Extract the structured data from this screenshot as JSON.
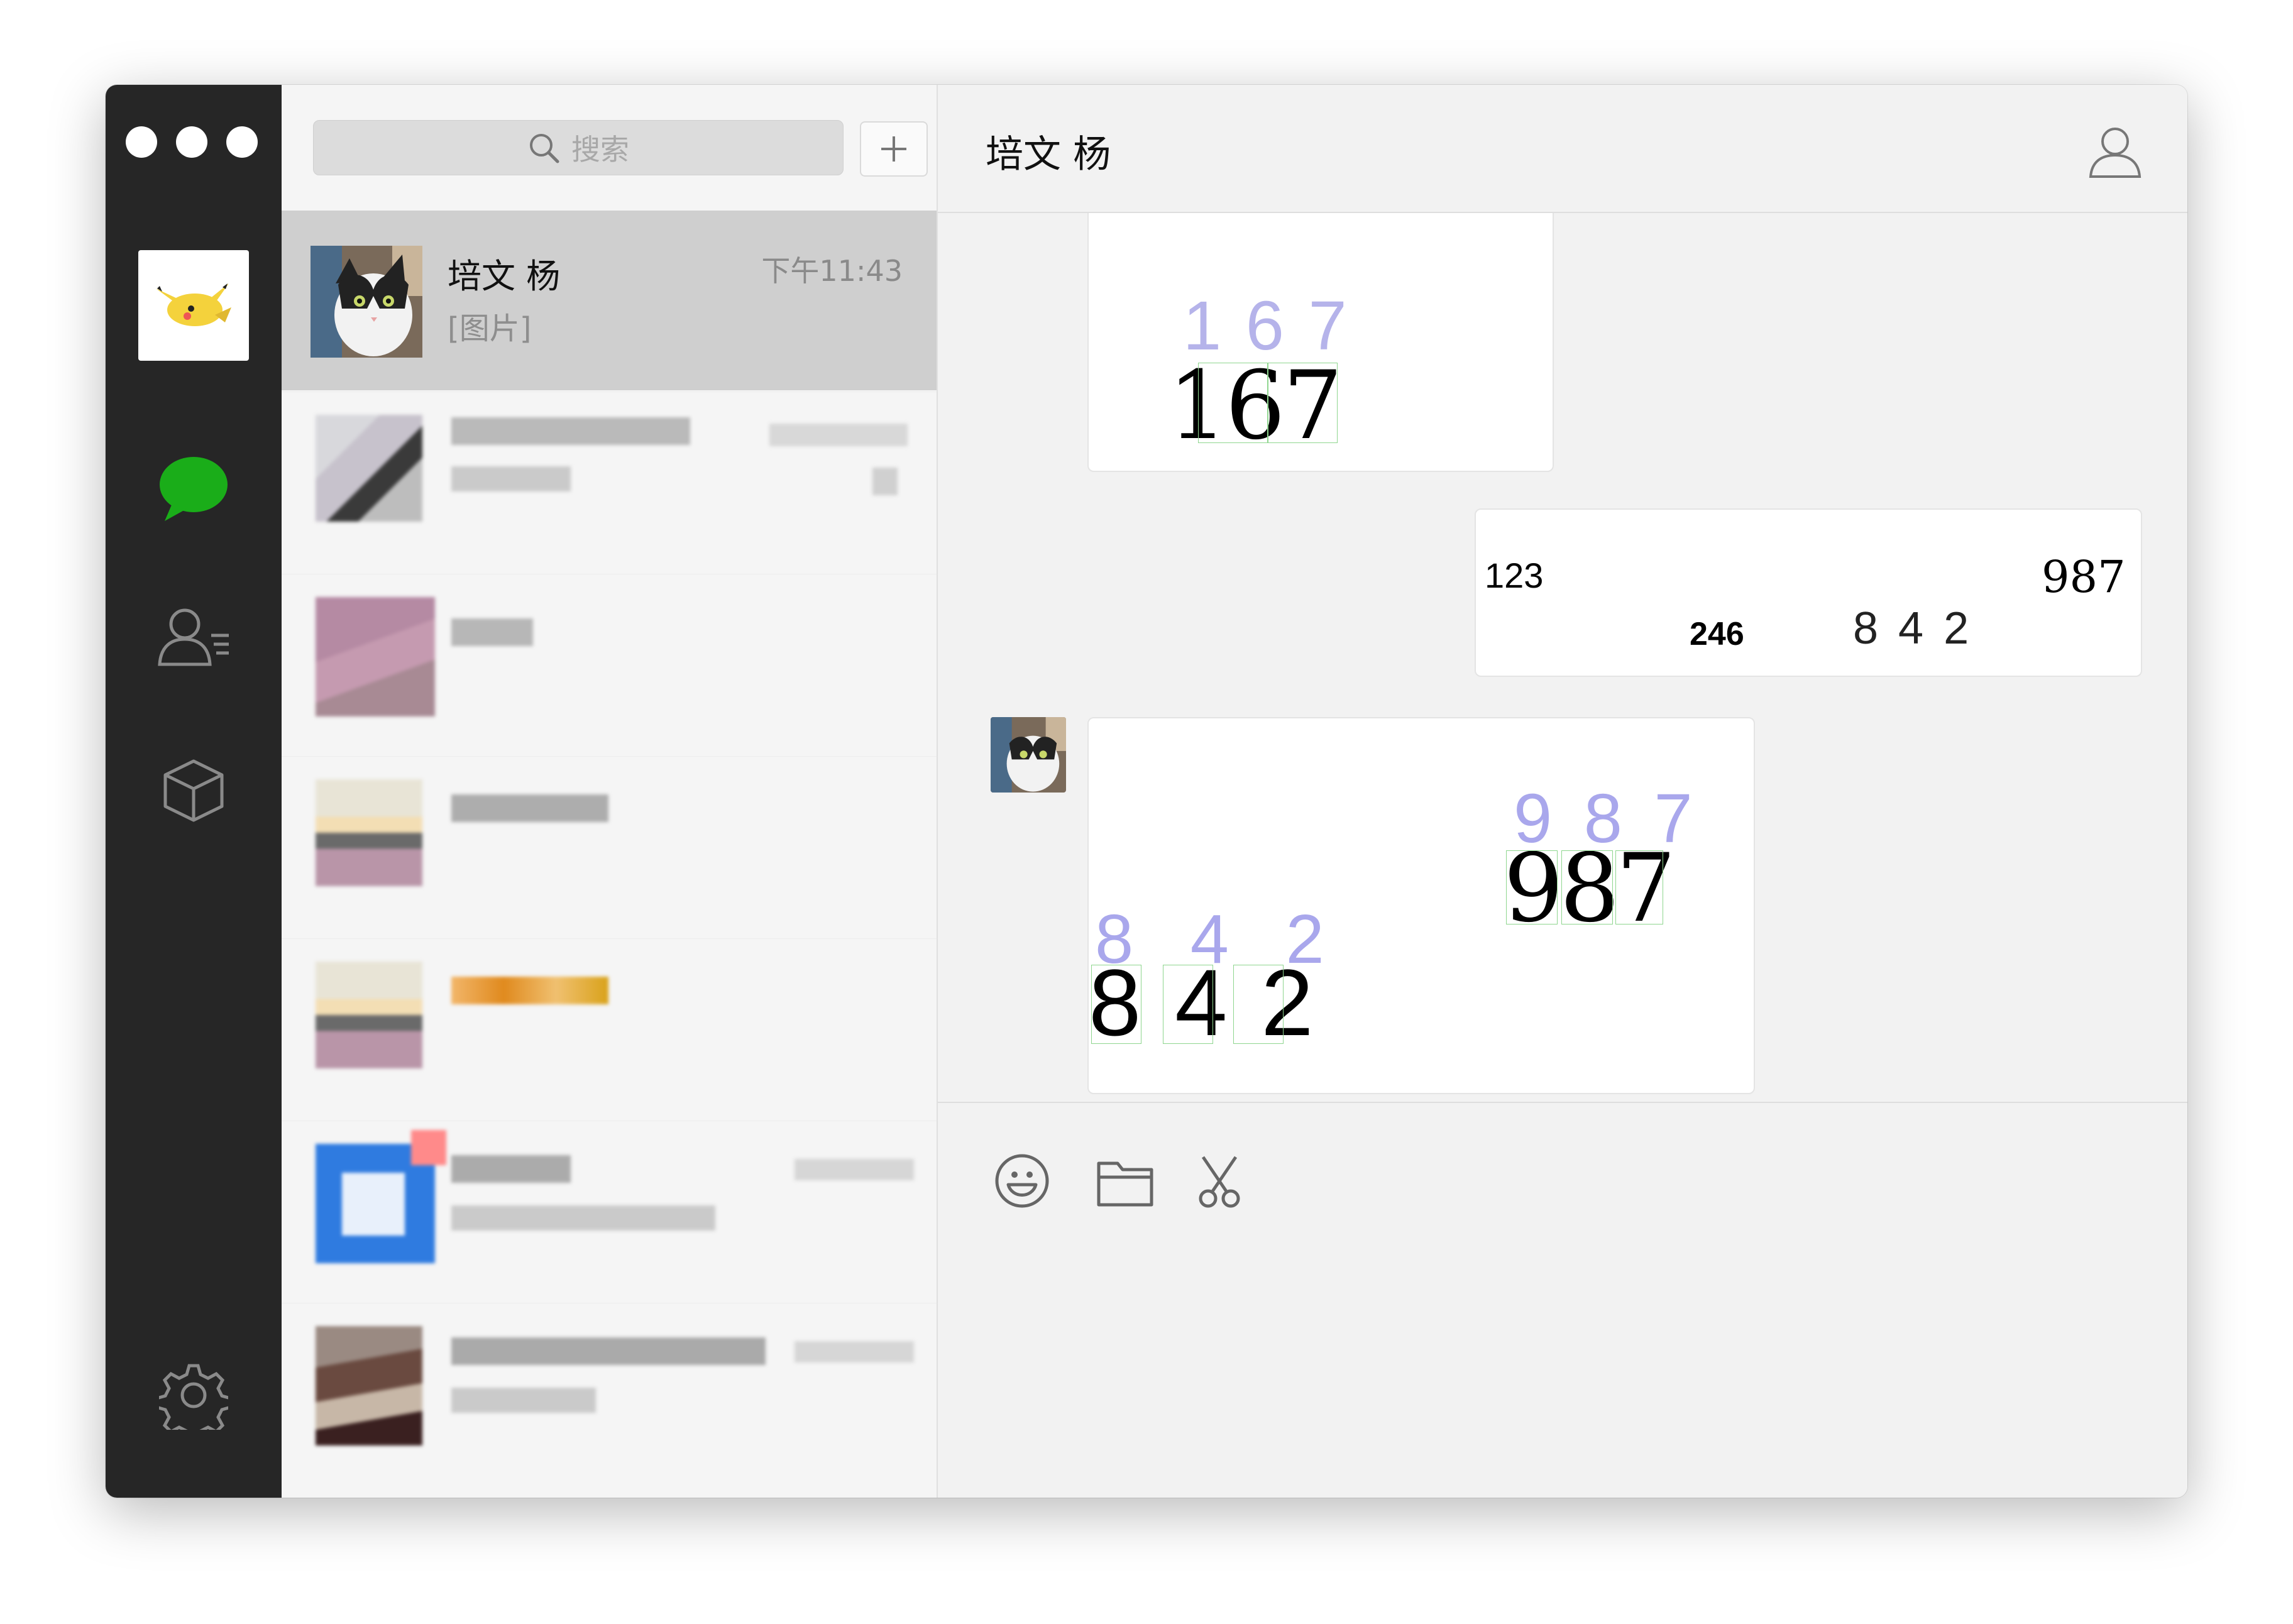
{
  "sidebar": {
    "icons": [
      "avatar-pikachu",
      "chat-bubble-icon",
      "contacts-icon",
      "cube-icon",
      "settings-gear-icon"
    ],
    "accent_color": "#1aad19"
  },
  "search": {
    "placeholder": "搜索"
  },
  "conversation_list": {
    "active": {
      "name": "培文 杨",
      "time": "下午11:43",
      "preview": "[图片]"
    }
  },
  "chat": {
    "title": "培文 杨",
    "messages": [
      {
        "from": "contact",
        "type": "image",
        "overlay": "1 6 7",
        "text": "167"
      },
      {
        "from": "me",
        "type": "image",
        "numbers": [
          "123",
          "987",
          "246",
          "8 4 2"
        ]
      },
      {
        "from": "contact",
        "type": "image",
        "overlays": [
          "9 8 7",
          "8 4 2"
        ],
        "texts": [
          "987",
          "8 4 2"
        ]
      }
    ]
  },
  "toolbar": {
    "icons": [
      "emoji-icon",
      "folder-icon",
      "scissors-icon"
    ]
  }
}
